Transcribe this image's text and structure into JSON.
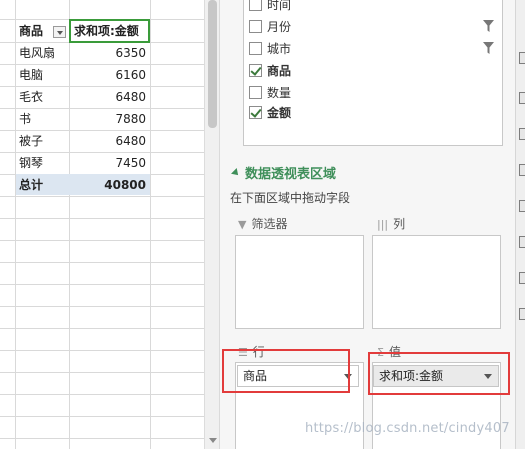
{
  "sheet": {
    "header": {
      "col_a": "商品",
      "col_b": "求和项:金额"
    },
    "rows": [
      {
        "name": "电风扇",
        "value": "6350"
      },
      {
        "name": "电脑",
        "value": "6160"
      },
      {
        "name": "毛衣",
        "value": "6480"
      },
      {
        "name": "书",
        "value": "7880"
      },
      {
        "name": "被子",
        "value": "6480"
      },
      {
        "name": "钢琴",
        "value": "7450"
      }
    ],
    "total": {
      "name": "总计",
      "value": "40800"
    }
  },
  "field_list": {
    "items": [
      {
        "label": "时间",
        "checked": false,
        "filtered": false
      },
      {
        "label": "月份",
        "checked": false,
        "filtered": true
      },
      {
        "label": "城市",
        "checked": false,
        "filtered": true
      },
      {
        "label": "商品",
        "checked": true,
        "filtered": false
      },
      {
        "label": "数量",
        "checked": false,
        "filtered": false
      },
      {
        "label": "金额",
        "checked": true,
        "filtered": false
      }
    ]
  },
  "pivot_area": {
    "title": "数据透视表区域",
    "hint": "在下面区域中拖动字段",
    "filters_label": "筛选器",
    "columns_label": "列",
    "rows_label": "行",
    "values_label": "值",
    "rows_field": "商品",
    "values_field": "求和项:金额"
  },
  "watermark": "https://blog.csdn.net/cindy407",
  "colors": {
    "accent_green": "#3f8f5a",
    "highlight_red": "#e23b3b",
    "total_row": "#dce6f1",
    "active_cell_border": "#3a9b3a"
  }
}
